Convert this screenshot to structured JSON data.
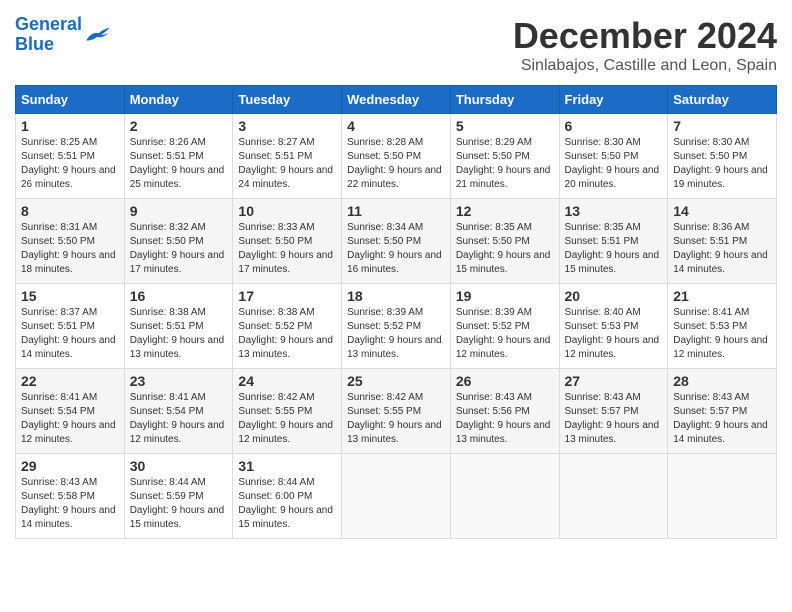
{
  "logo": {
    "line1": "General",
    "line2": "Blue"
  },
  "title": "December 2024",
  "location": "Sinlabajos, Castille and Leon, Spain",
  "weekdays": [
    "Sunday",
    "Monday",
    "Tuesday",
    "Wednesday",
    "Thursday",
    "Friday",
    "Saturday"
  ],
  "weeks": [
    [
      {
        "day": "1",
        "sunrise": "8:25 AM",
        "sunset": "5:51 PM",
        "daylight": "9 hours and 26 minutes."
      },
      {
        "day": "2",
        "sunrise": "8:26 AM",
        "sunset": "5:51 PM",
        "daylight": "9 hours and 25 minutes."
      },
      {
        "day": "3",
        "sunrise": "8:27 AM",
        "sunset": "5:51 PM",
        "daylight": "9 hours and 24 minutes."
      },
      {
        "day": "4",
        "sunrise": "8:28 AM",
        "sunset": "5:50 PM",
        "daylight": "9 hours and 22 minutes."
      },
      {
        "day": "5",
        "sunrise": "8:29 AM",
        "sunset": "5:50 PM",
        "daylight": "9 hours and 21 minutes."
      },
      {
        "day": "6",
        "sunrise": "8:30 AM",
        "sunset": "5:50 PM",
        "daylight": "9 hours and 20 minutes."
      },
      {
        "day": "7",
        "sunrise": "8:30 AM",
        "sunset": "5:50 PM",
        "daylight": "9 hours and 19 minutes."
      }
    ],
    [
      {
        "day": "8",
        "sunrise": "8:31 AM",
        "sunset": "5:50 PM",
        "daylight": "9 hours and 18 minutes."
      },
      {
        "day": "9",
        "sunrise": "8:32 AM",
        "sunset": "5:50 PM",
        "daylight": "9 hours and 17 minutes."
      },
      {
        "day": "10",
        "sunrise": "8:33 AM",
        "sunset": "5:50 PM",
        "daylight": "9 hours and 17 minutes."
      },
      {
        "day": "11",
        "sunrise": "8:34 AM",
        "sunset": "5:50 PM",
        "daylight": "9 hours and 16 minutes."
      },
      {
        "day": "12",
        "sunrise": "8:35 AM",
        "sunset": "5:50 PM",
        "daylight": "9 hours and 15 minutes."
      },
      {
        "day": "13",
        "sunrise": "8:35 AM",
        "sunset": "5:51 PM",
        "daylight": "9 hours and 15 minutes."
      },
      {
        "day": "14",
        "sunrise": "8:36 AM",
        "sunset": "5:51 PM",
        "daylight": "9 hours and 14 minutes."
      }
    ],
    [
      {
        "day": "15",
        "sunrise": "8:37 AM",
        "sunset": "5:51 PM",
        "daylight": "9 hours and 14 minutes."
      },
      {
        "day": "16",
        "sunrise": "8:38 AM",
        "sunset": "5:51 PM",
        "daylight": "9 hours and 13 minutes."
      },
      {
        "day": "17",
        "sunrise": "8:38 AM",
        "sunset": "5:52 PM",
        "daylight": "9 hours and 13 minutes."
      },
      {
        "day": "18",
        "sunrise": "8:39 AM",
        "sunset": "5:52 PM",
        "daylight": "9 hours and 13 minutes."
      },
      {
        "day": "19",
        "sunrise": "8:39 AM",
        "sunset": "5:52 PM",
        "daylight": "9 hours and 12 minutes."
      },
      {
        "day": "20",
        "sunrise": "8:40 AM",
        "sunset": "5:53 PM",
        "daylight": "9 hours and 12 minutes."
      },
      {
        "day": "21",
        "sunrise": "8:41 AM",
        "sunset": "5:53 PM",
        "daylight": "9 hours and 12 minutes."
      }
    ],
    [
      {
        "day": "22",
        "sunrise": "8:41 AM",
        "sunset": "5:54 PM",
        "daylight": "9 hours and 12 minutes."
      },
      {
        "day": "23",
        "sunrise": "8:41 AM",
        "sunset": "5:54 PM",
        "daylight": "9 hours and 12 minutes."
      },
      {
        "day": "24",
        "sunrise": "8:42 AM",
        "sunset": "5:55 PM",
        "daylight": "9 hours and 12 minutes."
      },
      {
        "day": "25",
        "sunrise": "8:42 AM",
        "sunset": "5:55 PM",
        "daylight": "9 hours and 13 minutes."
      },
      {
        "day": "26",
        "sunrise": "8:43 AM",
        "sunset": "5:56 PM",
        "daylight": "9 hours and 13 minutes."
      },
      {
        "day": "27",
        "sunrise": "8:43 AM",
        "sunset": "5:57 PM",
        "daylight": "9 hours and 13 minutes."
      },
      {
        "day": "28",
        "sunrise": "8:43 AM",
        "sunset": "5:57 PM",
        "daylight": "9 hours and 14 minutes."
      }
    ],
    [
      {
        "day": "29",
        "sunrise": "8:43 AM",
        "sunset": "5:58 PM",
        "daylight": "9 hours and 14 minutes."
      },
      {
        "day": "30",
        "sunrise": "8:44 AM",
        "sunset": "5:59 PM",
        "daylight": "9 hours and 15 minutes."
      },
      {
        "day": "31",
        "sunrise": "8:44 AM",
        "sunset": "6:00 PM",
        "daylight": "9 hours and 15 minutes."
      },
      null,
      null,
      null,
      null
    ]
  ]
}
